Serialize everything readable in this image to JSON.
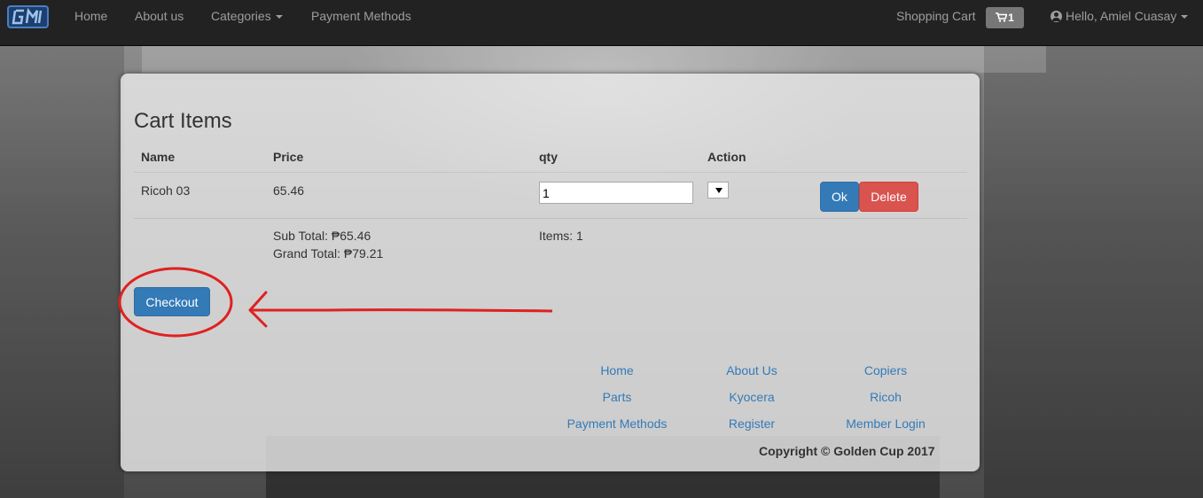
{
  "navbar": {
    "brand_alt": "GCI",
    "links": [
      {
        "label": "Home"
      },
      {
        "label": "About us"
      },
      {
        "label": "Categories"
      },
      {
        "label": "Payment Methods"
      }
    ],
    "cart_label": "Shopping Cart",
    "cart_count": "1",
    "user_label": "Hello, Amiel Cuasay",
    "icons": {
      "cart": "shopping-cart-icon",
      "user": "user-circle-icon",
      "caret": "caret-down-icon"
    }
  },
  "cart": {
    "title": "Cart Items",
    "columns": [
      "Name",
      "Price",
      "qty",
      "Action"
    ],
    "rows": [
      {
        "name": "Ricoh 03",
        "price": "65.46",
        "qty": "1",
        "ok_label": "Ok",
        "delete_label": "Delete"
      }
    ],
    "sub_total": "Sub Total: ₱65.46",
    "grand_total": "Grand Total: ₱79.21",
    "items": "Items: 1",
    "checkout_label": "Checkout"
  },
  "footer": {
    "links": [
      [
        "Home",
        "About Us",
        "Copiers"
      ],
      [
        "Parts",
        "Kyocera",
        "Ricoh"
      ],
      [
        "Payment Methods",
        "Register",
        "Member Login"
      ]
    ],
    "copyright": "Copyright © Golden Cup 2017"
  },
  "colors": {
    "navbar_bg": "#222222",
    "nav_text": "#9d9d9d",
    "primary": "#337ab7",
    "danger": "#d9534f",
    "annotation": "#e02020"
  }
}
